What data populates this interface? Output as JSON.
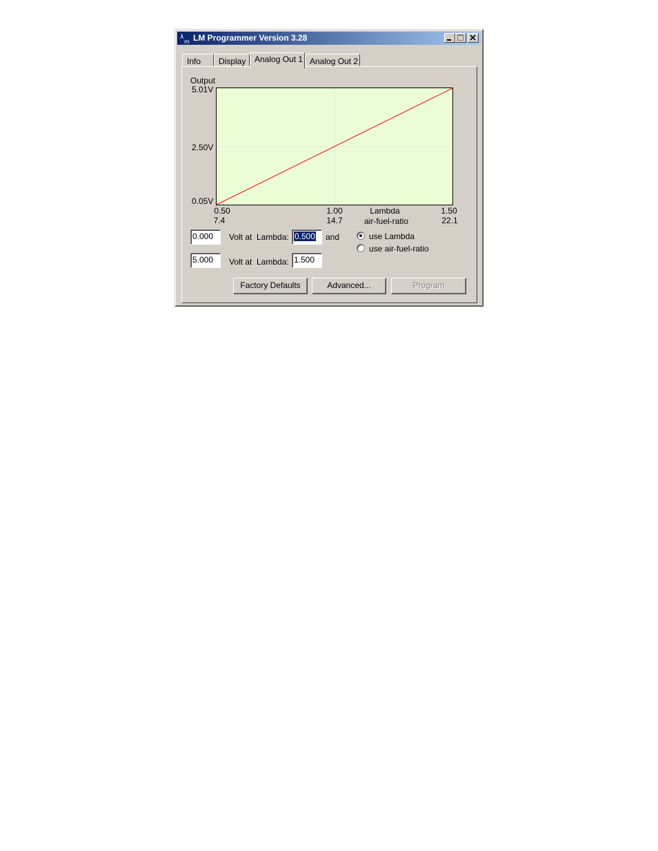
{
  "window": {
    "title": "LM Programmer Version 3.28",
    "app_icon": "lambda-app-icon",
    "caption_buttons": [
      "minimize-icon",
      "maximize-icon",
      "close-icon"
    ]
  },
  "tabs": [
    {
      "label": "Info",
      "active": false
    },
    {
      "label": "Display",
      "active": false
    },
    {
      "label": "Analog Out 1",
      "active": true
    },
    {
      "label": "Analog Out 2",
      "active": false
    }
  ],
  "chart": {
    "ylabel": "Output",
    "y_ticks": [
      "5.01V",
      "2.50V",
      "0.05V"
    ],
    "x_ticks_lambda": [
      "0.50",
      "1.00",
      "1.50"
    ],
    "x_ticks_afr": [
      "7.4",
      "14.7",
      "22.1"
    ],
    "xlabel_lambda": "Lambda",
    "xlabel_afr": "air-fuel-ratio",
    "colors": {
      "background": "#ebfdd6",
      "line": "#ff0000",
      "grid": "#e6e6e6"
    }
  },
  "chart_data": {
    "type": "line",
    "x": [
      0.5,
      1.5
    ],
    "y": [
      0.05,
      5.01
    ],
    "xlim": [
      0.5,
      1.5
    ],
    "ylim": [
      0.05,
      5.01
    ],
    "grid": true
  },
  "form": {
    "row1": {
      "volt_value": "0.000",
      "volt_label": "Volt at",
      "lambda_label": "Lambda:",
      "lambda_value": "0.500",
      "and_label": "and"
    },
    "row2": {
      "volt_value": "5.000",
      "volt_label": "Volt at",
      "lambda_label": "Lambda:",
      "lambda_value": "1.500"
    },
    "radio_lambda": {
      "label": "use Lambda",
      "checked": true
    },
    "radio_afr": {
      "label": "use air-fuel-ratio",
      "checked": false
    }
  },
  "buttons": {
    "factory_defaults": "Factory Defaults",
    "advanced": "Advanced...",
    "program": "Program",
    "program_enabled": false
  }
}
